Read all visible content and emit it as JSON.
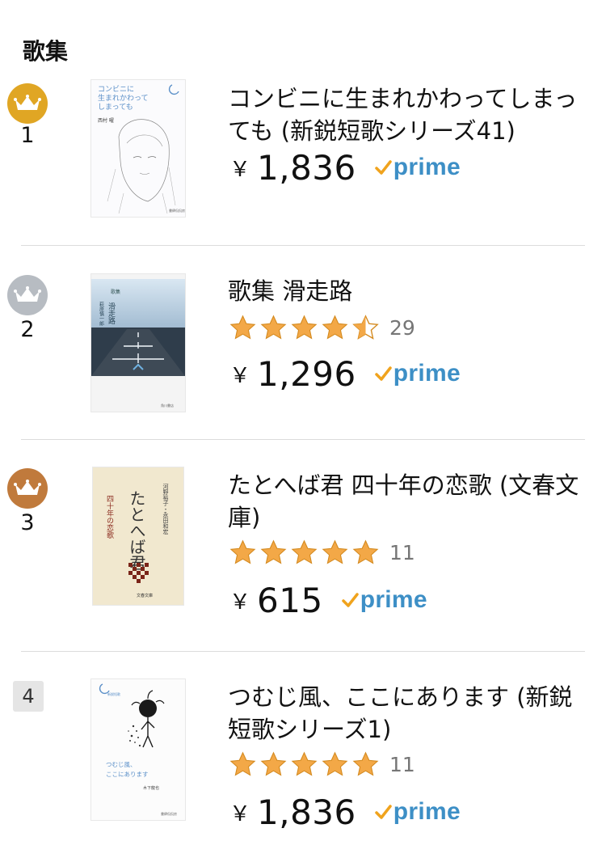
{
  "category": {
    "title": "歌集"
  },
  "colors": {
    "gold": "#e0a624",
    "silver": "#b7bcc2",
    "bronze": "#c07a3c",
    "star": "#f3a847",
    "prime": "#3d8fc6",
    "check": "#f0a31d"
  },
  "items": [
    {
      "rank": "1",
      "title": "コンビニに生まれかわってしまっても (新鋭短歌シリーズ41)",
      "yen": "￥",
      "price": "1,836",
      "prime": "prime",
      "cover": {
        "title_text": "コンビニに生まれかわってしまっても",
        "author": "西村 曜"
      }
    },
    {
      "rank": "2",
      "title": "歌集 滑走路",
      "rating": 4.5,
      "reviews": "29",
      "yen": "￥",
      "price": "1,296",
      "prime": "prime",
      "cover": {
        "title_text": "滑走路",
        "author": "萩原慎一郎",
        "small": "歌集"
      }
    },
    {
      "rank": "3",
      "title": "たとへば君 四十年の恋歌 (文春文庫)",
      "rating": 5,
      "reviews": "11",
      "yen": "￥",
      "price": "615",
      "prime": "prime",
      "cover": {
        "title_text": "たとへば君",
        "subtitle": "四十年の恋歌",
        "author": "河野裕子・永田和宏",
        "publisher": "文春文庫"
      }
    },
    {
      "rank": "4",
      "title": "つむじ風、ここにあります (新鋭短歌シリーズ1)",
      "rating": 5,
      "reviews": "11",
      "yen": "￥",
      "price": "1,836",
      "prime": "prime",
      "cover": {
        "title_text": "つむじ風、ここにあります",
        "author": "木下龍也"
      }
    }
  ]
}
